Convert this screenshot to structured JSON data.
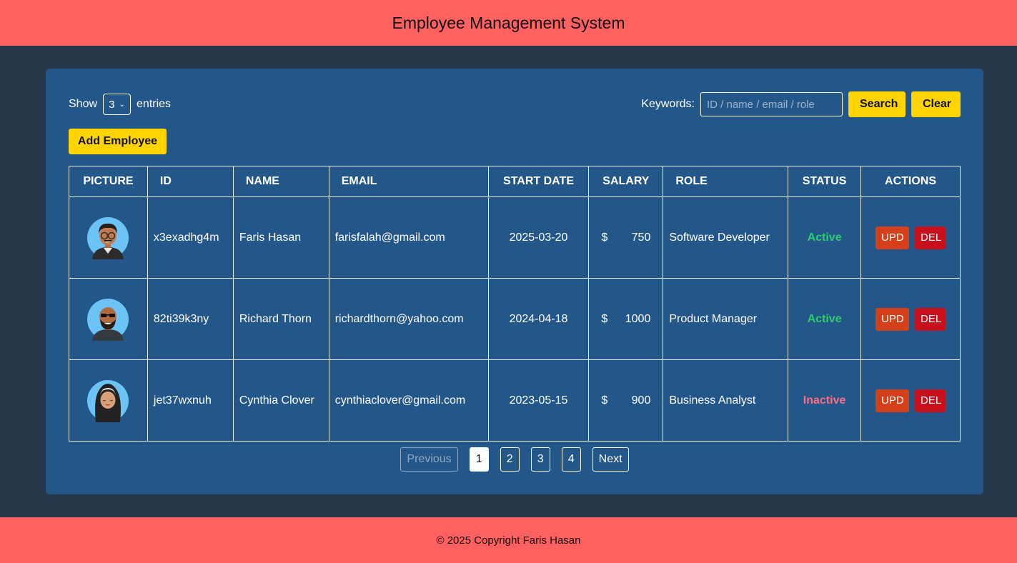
{
  "header": {
    "title": "Employee Management System"
  },
  "controls": {
    "show_label": "Show",
    "entries_value": "3",
    "entries_label": "entries",
    "keywords_label": "Keywords:",
    "search_placeholder": "ID / name / email / role",
    "search_label": "Search",
    "clear_label": "Clear",
    "add_label": "Add Employee"
  },
  "table": {
    "headers": [
      "PICTURE",
      "ID",
      "NAME",
      "EMAIL",
      "START DATE",
      "SALARY",
      "ROLE",
      "STATUS",
      "ACTIONS"
    ],
    "currency": "$",
    "upd_label": "UPD",
    "del_label": "DEL",
    "rows": [
      {
        "id": "x3exadhg4m",
        "name": "Faris Hasan",
        "email": "farisfalah@gmail.com",
        "start_date": "2025-03-20",
        "salary": "750",
        "role": "Software Developer",
        "status": "Active"
      },
      {
        "id": "82ti39k3ny",
        "name": "Richard Thorn",
        "email": "richardthorn@yahoo.com",
        "start_date": "2024-04-18",
        "salary": "1000",
        "role": "Product Manager",
        "status": "Active"
      },
      {
        "id": "jet37wxnuh",
        "name": "Cynthia Clover",
        "email": "cynthiaclover@gmail.com",
        "start_date": "2023-05-15",
        "salary": "900",
        "role": "Business Analyst",
        "status": "Inactive"
      }
    ]
  },
  "pagination": {
    "previous_label": "Previous",
    "pages": [
      "1",
      "2",
      "3",
      "4"
    ],
    "current": "1",
    "next_label": "Next"
  },
  "footer": {
    "text": "© 2025 Copyright Faris Hasan"
  },
  "colors": {
    "header_bg": "#ff6161",
    "page_bg": "#283747",
    "panel_bg": "#245789",
    "accent_yellow": "#ffd400",
    "active": "#2ecc71",
    "inactive": "#ff6b81",
    "update": "#d5401a",
    "delete": "#c8101c"
  },
  "icons": {
    "picture": "avatar-icon",
    "select": "chevron-down-icon"
  }
}
